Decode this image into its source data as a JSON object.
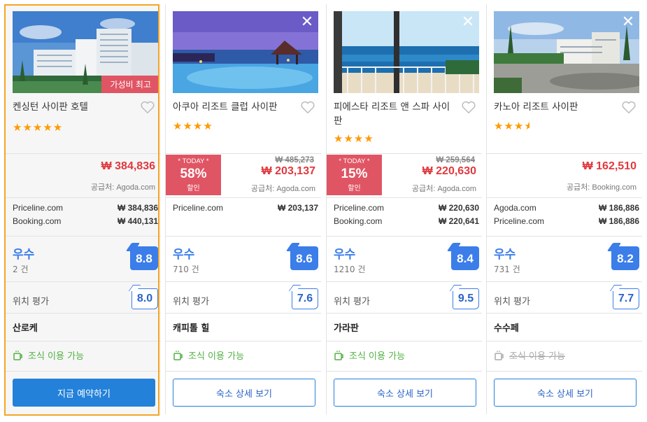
{
  "hotels": [
    {
      "name": "켄싱턴 사이판 호텔",
      "stars": "★★★★★",
      "badge": "가성비 최고",
      "price": "₩ 384,836",
      "old_price": "",
      "supplier": "공급처: Agoda.com",
      "today": null,
      "providers": [
        {
          "name": "Priceline.com",
          "price": "₩ 384,836"
        },
        {
          "name": "Booking.com",
          "price": "₩ 440,131"
        }
      ],
      "rating_word": "우수",
      "rating_count": "2 건",
      "score": "8.8",
      "location_label": "위치 평가",
      "location_score": "8.0",
      "area": "산로케",
      "breakfast": "조식 이용 가능",
      "button": "지금 예약하기"
    },
    {
      "name": "아쿠아 리조트 클럽 사이판",
      "stars": "★★★★",
      "price": "₩ 203,137",
      "old_price": "₩ 485,273",
      "supplier": "공급처: Agoda.com",
      "today": {
        "label": "* TODAY *",
        "pct": "58%",
        "sub": "할인"
      },
      "providers": [
        {
          "name": "Priceline.com",
          "price": "₩ 203,137"
        }
      ],
      "rating_word": "우수",
      "rating_count": "710 건",
      "score": "8.6",
      "location_label": "위치 평가",
      "location_score": "7.6",
      "area": "캐피톨 힐",
      "breakfast": "조식 이용 가능",
      "button": "숙소 상세 보기"
    },
    {
      "name": "피에스타 리조트 앤 스파 사이판",
      "stars": "★★★★",
      "price": "₩ 220,630",
      "old_price": "₩ 259,564",
      "supplier": "공급처: Agoda.com",
      "today": {
        "label": "* TODAY *",
        "pct": "15%",
        "sub": "할인"
      },
      "providers": [
        {
          "name": "Priceline.com",
          "price": "₩ 220,630"
        },
        {
          "name": "Booking.com",
          "price": "₩ 220,641"
        }
      ],
      "rating_word": "우수",
      "rating_count": "1210 건",
      "score": "8.4",
      "location_label": "위치 평가",
      "location_score": "9.5",
      "area": "가라판",
      "breakfast": "조식 이용 가능",
      "button": "숙소 상세 보기"
    },
    {
      "name": "카노아 리조트 사이판",
      "stars": "★★★",
      "half_star": "★",
      "price": "₩ 162,510",
      "old_price": "",
      "supplier": "공급처: Booking.com",
      "today": null,
      "providers": [
        {
          "name": "Agoda.com",
          "price": "₩ 186,886"
        },
        {
          "name": "Priceline.com",
          "price": "₩ 186,886"
        }
      ],
      "rating_word": "우수",
      "rating_count": "731 건",
      "score": "8.2",
      "location_label": "위치 평가",
      "location_score": "7.7",
      "area": "수수페",
      "breakfast": "조식 이용 가능",
      "button": "숙소 상세 보기"
    }
  ],
  "close_glyph": "✕",
  "colors": {
    "accent": "#2481d9",
    "price": "#e0393e",
    "discount": "#e05564",
    "selected_border": "#f5a623",
    "breakfast": "#52b043",
    "star": "#ff9a00"
  }
}
